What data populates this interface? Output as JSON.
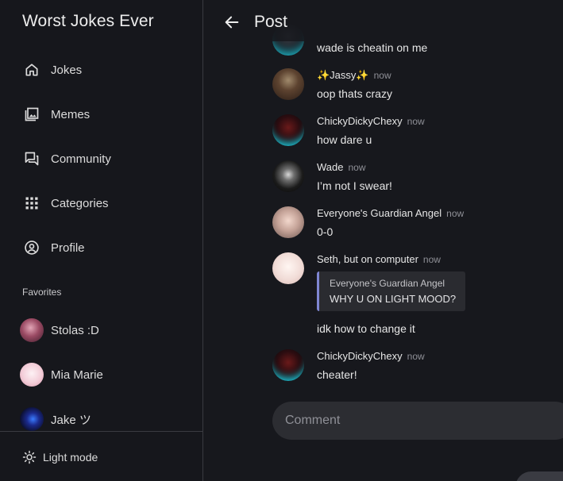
{
  "app": {
    "title": "Worst Jokes Ever"
  },
  "nav": [
    {
      "label": "Jokes",
      "icon": "home-icon"
    },
    {
      "label": "Memes",
      "icon": "image-icon"
    },
    {
      "label": "Community",
      "icon": "forum-icon"
    },
    {
      "label": "Categories",
      "icon": "grid-icon"
    },
    {
      "label": "Profile",
      "icon": "account-circle-icon"
    }
  ],
  "favorites": {
    "header": "Favorites",
    "items": [
      {
        "label": "Stolas :D"
      },
      {
        "label": "Mia Marie"
      },
      {
        "label": "Jake ツ"
      }
    ]
  },
  "footer": {
    "light_mode": "Light mode"
  },
  "header": {
    "title": "Post"
  },
  "comments": [
    {
      "author": "",
      "time": "",
      "body": "wade is cheatin on me"
    },
    {
      "author": "✨Jassy✨",
      "time": "now",
      "body": "oop thats crazy"
    },
    {
      "author": "ChickyDickyChexy",
      "time": "now",
      "body": "how dare u"
    },
    {
      "author": "Wade",
      "time": "now",
      "body": "I’m not I swear!"
    },
    {
      "author": "Everyone's Guardian Angel",
      "time": "now",
      "body": "0-0"
    },
    {
      "author": "Seth, but on computer",
      "time": "now",
      "quote_author": "Everyone's Guardian Angel",
      "quote_text": "WHY U ON LIGHT MOOD?",
      "body": "idk how to change it"
    },
    {
      "author": "ChickyDickyChexy",
      "time": "now",
      "body": "cheater!"
    }
  ],
  "composer": {
    "placeholder": "Comment"
  },
  "colors": {
    "background": "#16171c",
    "surface": "#2c2d32",
    "quote_accent": "#7f86d3",
    "divider": "#3a3b41"
  }
}
